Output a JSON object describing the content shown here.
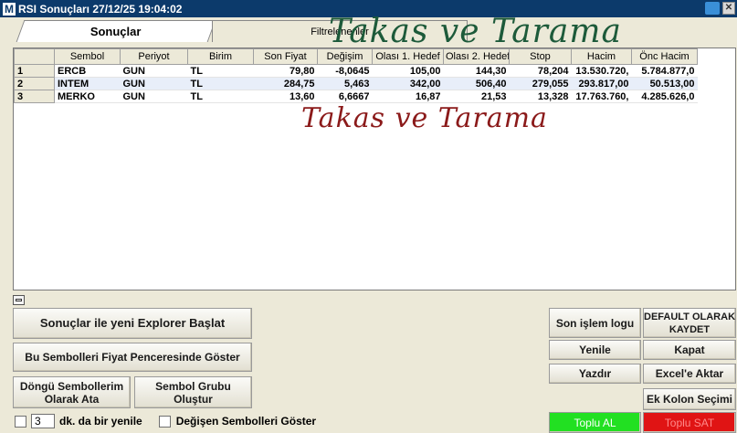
{
  "window": {
    "app_letter": "M",
    "title": "RSI Sonuçları  27/12/25 19:04:02"
  },
  "tabs": [
    {
      "label": "Sonuçlar"
    },
    {
      "label": "Filtrelenenler"
    }
  ],
  "watermark": {
    "top": "Takas ve Tarama",
    "middle": "Takas ve Tarama"
  },
  "table": {
    "columns": [
      "",
      "Sembol",
      "Periyot",
      "Birim",
      "Son Fiyat",
      "Değişim",
      "Olası 1. Hedef",
      "Olası 2. Hedef",
      "Stop",
      "Hacim",
      "Önc Hacim"
    ],
    "rows": [
      [
        "1",
        "ERCB",
        "GUN",
        "TL",
        "79,80",
        "-8,0645",
        "105,00",
        "144,30",
        "78,204",
        "13.530.720,",
        "5.784.877,0"
      ],
      [
        "2",
        "INTEM",
        "GUN",
        "TL",
        "284,75",
        "5,463",
        "342,00",
        "506,40",
        "279,055",
        "293.817,00",
        "50.513,00"
      ],
      [
        "3",
        "MERKO",
        "GUN",
        "TL",
        "13,60",
        "6,6667",
        "16,87",
        "21,53",
        "13,328",
        "17.763.760,",
        "4.285.626,0"
      ]
    ]
  },
  "buttons": {
    "new_explorer": "Sonuçlar ile yeni Explorer Başlat",
    "show_in_price": "Bu Sembolleri Fiyat Penceresinde Göster",
    "loop_symbols": "Döngü Sembollerim Olarak Ata",
    "symbol_group": "Sembol Grubu Oluştur",
    "last_log": "Son işlem logu",
    "save_default": "DEFAULT OLARAK KAYDET",
    "refresh": "Yenile",
    "close": "Kapat",
    "print": "Yazdır",
    "excel": "Excel'e Aktar",
    "extra_cols": "Ek Kolon Seçimi",
    "buy_all": "Toplu AL",
    "sell_all": "Toplu SAT"
  },
  "footer": {
    "refresh_minutes": "3",
    "refresh_label": "dk. da bir yenile",
    "show_changed_label": "Değişen Sembolleri Göster"
  }
}
